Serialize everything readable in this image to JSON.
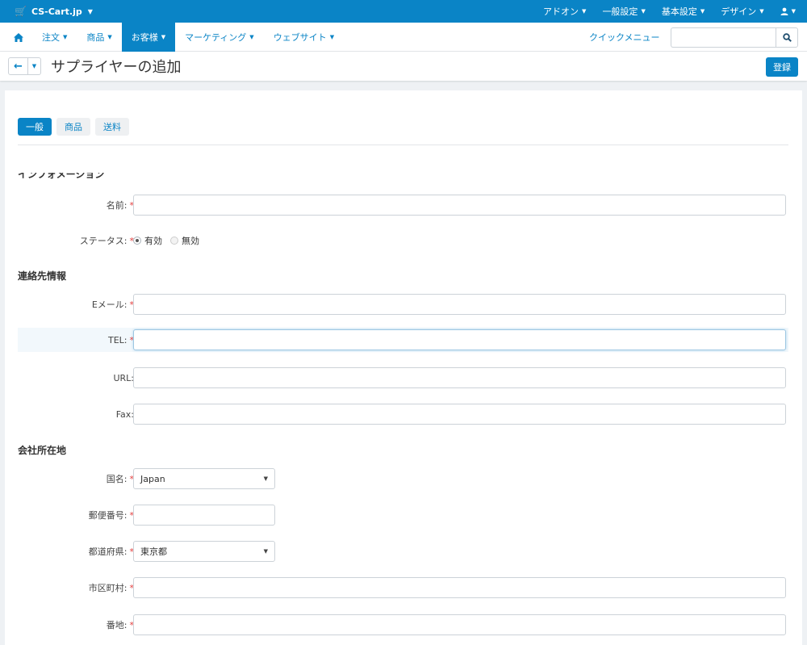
{
  "topbar": {
    "brand": "CS-Cart.jp",
    "menus": [
      "アドオン",
      "一般設定",
      "基本設定",
      "デザイン"
    ]
  },
  "nav": {
    "items": [
      {
        "label": "注文"
      },
      {
        "label": "商品"
      },
      {
        "label": "お客様",
        "active": true
      },
      {
        "label": "マーケティング"
      },
      {
        "label": "ウェブサイト"
      }
    ],
    "quick_menu": "クイックメニュー",
    "search_placeholder": ""
  },
  "page": {
    "title": "サプライヤーの追加",
    "save_label": "登録"
  },
  "tabs": [
    "一般",
    "商品",
    "送料"
  ],
  "sections": {
    "info": "インフォメーション",
    "contact": "連絡先情報",
    "address": "会社所在地"
  },
  "fields": {
    "name": {
      "label": "名前:",
      "value": ""
    },
    "status": {
      "label": "ステータス:",
      "options": [
        "有効",
        "無効"
      ],
      "selected": "有効"
    },
    "email": {
      "label": "Eメール:",
      "value": ""
    },
    "tel": {
      "label": "TEL:",
      "value": ""
    },
    "url": {
      "label": "URL:",
      "value": ""
    },
    "fax": {
      "label": "Fax:",
      "value": ""
    },
    "country": {
      "label": "国名:",
      "value": "Japan"
    },
    "zip": {
      "label": "郵便番号:",
      "value": ""
    },
    "state": {
      "label": "都道府県:",
      "value": "東京都"
    },
    "city": {
      "label": "市区町村:",
      "value": ""
    },
    "address": {
      "label": "番地:",
      "value": ""
    }
  },
  "colors": {
    "primary": "#0a84c6",
    "required": "#e23b3b"
  }
}
